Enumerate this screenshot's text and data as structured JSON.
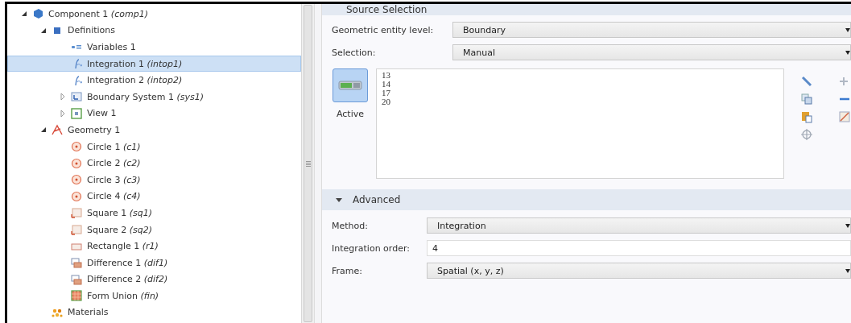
{
  "tree": [
    {
      "kind": "component",
      "label": "Component 1 *(comp1)*",
      "expanded": true,
      "selected": false,
      "children": [
        {
          "kind": "definitions",
          "label": "Definitions",
          "expanded": true,
          "selected": false,
          "children": [
            {
              "kind": "variables",
              "label": "Variables 1",
              "selected": false
            },
            {
              "kind": "integration",
              "label": "Integration 1 *(intop1)*",
              "selected": true
            },
            {
              "kind": "integration",
              "label": "Integration 2 *(intop2)*",
              "selected": false
            },
            {
              "kind": "coordinate-system",
              "label": "Boundary System 1 *(sys1)*",
              "expanded": false,
              "selected": false
            },
            {
              "kind": "view",
              "label": "View 1",
              "expanded": false,
              "selected": false
            }
          ]
        },
        {
          "kind": "geometry",
          "label": "Geometry 1",
          "expanded": true,
          "selected": false,
          "children": [
            {
              "kind": "circle",
              "label": "Circle 1 *(c1)*",
              "selected": false
            },
            {
              "kind": "circle",
              "label": "Circle 2 *(c2)*",
              "selected": false
            },
            {
              "kind": "circle",
              "label": "Circle 3 *(c3)*",
              "selected": false
            },
            {
              "kind": "circle",
              "label": "Circle 4 *(c4)*",
              "selected": false
            },
            {
              "kind": "square",
              "label": "Square 1 *(sq1)*",
              "selected": false
            },
            {
              "kind": "square",
              "label": "Square 2 *(sq2)*",
              "selected": false
            },
            {
              "kind": "rectangle",
              "label": "Rectangle 1 *(r1)*",
              "selected": false
            },
            {
              "kind": "difference",
              "label": "Difference 1 *(dif1)*",
              "selected": false
            },
            {
              "kind": "difference",
              "label": "Difference 2 *(dif2)*",
              "selected": false
            },
            {
              "kind": "form-union",
              "label": "Form Union *(fin)*",
              "selected": false
            }
          ]
        },
        {
          "kind": "materials",
          "label": "Materials",
          "selected": false
        }
      ]
    }
  ],
  "source_selection": {
    "title": "Source Selection",
    "fields": [
      {
        "kind": "dropdown",
        "label": "Geometric entity level:",
        "value": "Boundary"
      },
      {
        "kind": "dropdown",
        "label": "Selection:",
        "value": "Manual"
      }
    ],
    "active": {
      "label": "Active",
      "on": true
    },
    "entities": [
      "13",
      "14",
      "17",
      "20"
    ]
  },
  "advanced": {
    "title": "Advanced",
    "expanded": true,
    "fields": [
      {
        "kind": "dropdown",
        "label": "Method:",
        "value": "Integration"
      },
      {
        "kind": "text",
        "label": "Integration order:",
        "value": "4"
      },
      {
        "kind": "dropdown",
        "label": "Frame:",
        "value": "Spatial  (x, y, z)"
      }
    ]
  }
}
